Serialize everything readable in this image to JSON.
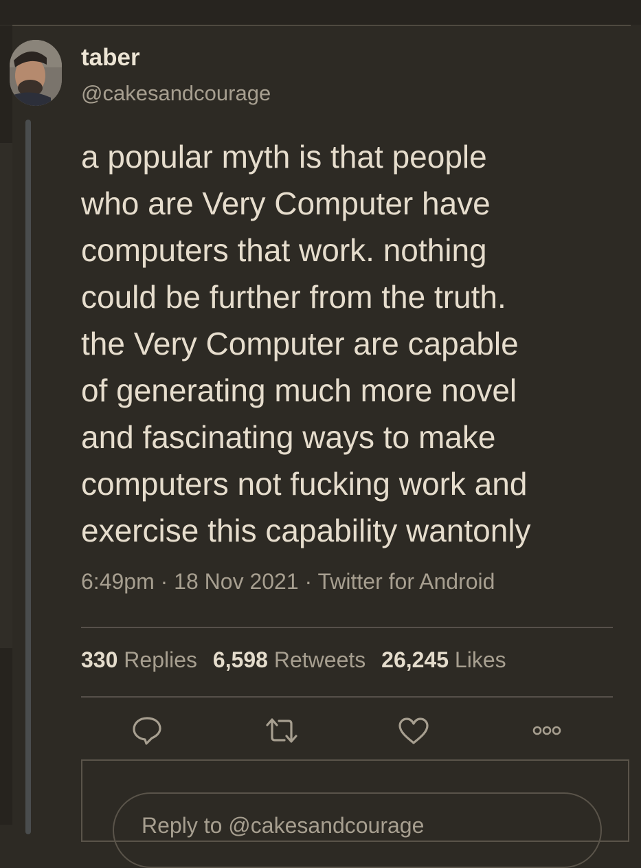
{
  "tweet": {
    "display_name": "taber",
    "handle": "@cakesandcourage",
    "text": "a popular myth is that people\nwho are Very Computer have\ncomputers that work. nothing\ncould be further from the truth.\nthe Very Computer are capable\nof generating much more novel\nand fascinating ways to make\ncomputers not fucking work and\nexercise this capability wantonly",
    "time": "6:49pm",
    "date": "18 Nov 2021",
    "source": "Twitter for Android",
    "separator": " · "
  },
  "stats": {
    "replies_count": "330",
    "replies_label": "Replies",
    "retweets_count": "6,598",
    "retweets_label": "Retweets",
    "likes_count": "26,245",
    "likes_label": "Likes"
  },
  "actions": {
    "reply_icon": "speech-bubble-icon",
    "retweet_icon": "retweet-icon",
    "like_icon": "heart-icon",
    "more_icon": "more-options-icon"
  },
  "reply_box": {
    "placeholder": "Reply to @cakesandcourage"
  },
  "colors": {
    "background": "#2d2a24",
    "text_primary": "#e6ddcd",
    "text_secondary": "#a79f90",
    "divider": "#56504a"
  }
}
